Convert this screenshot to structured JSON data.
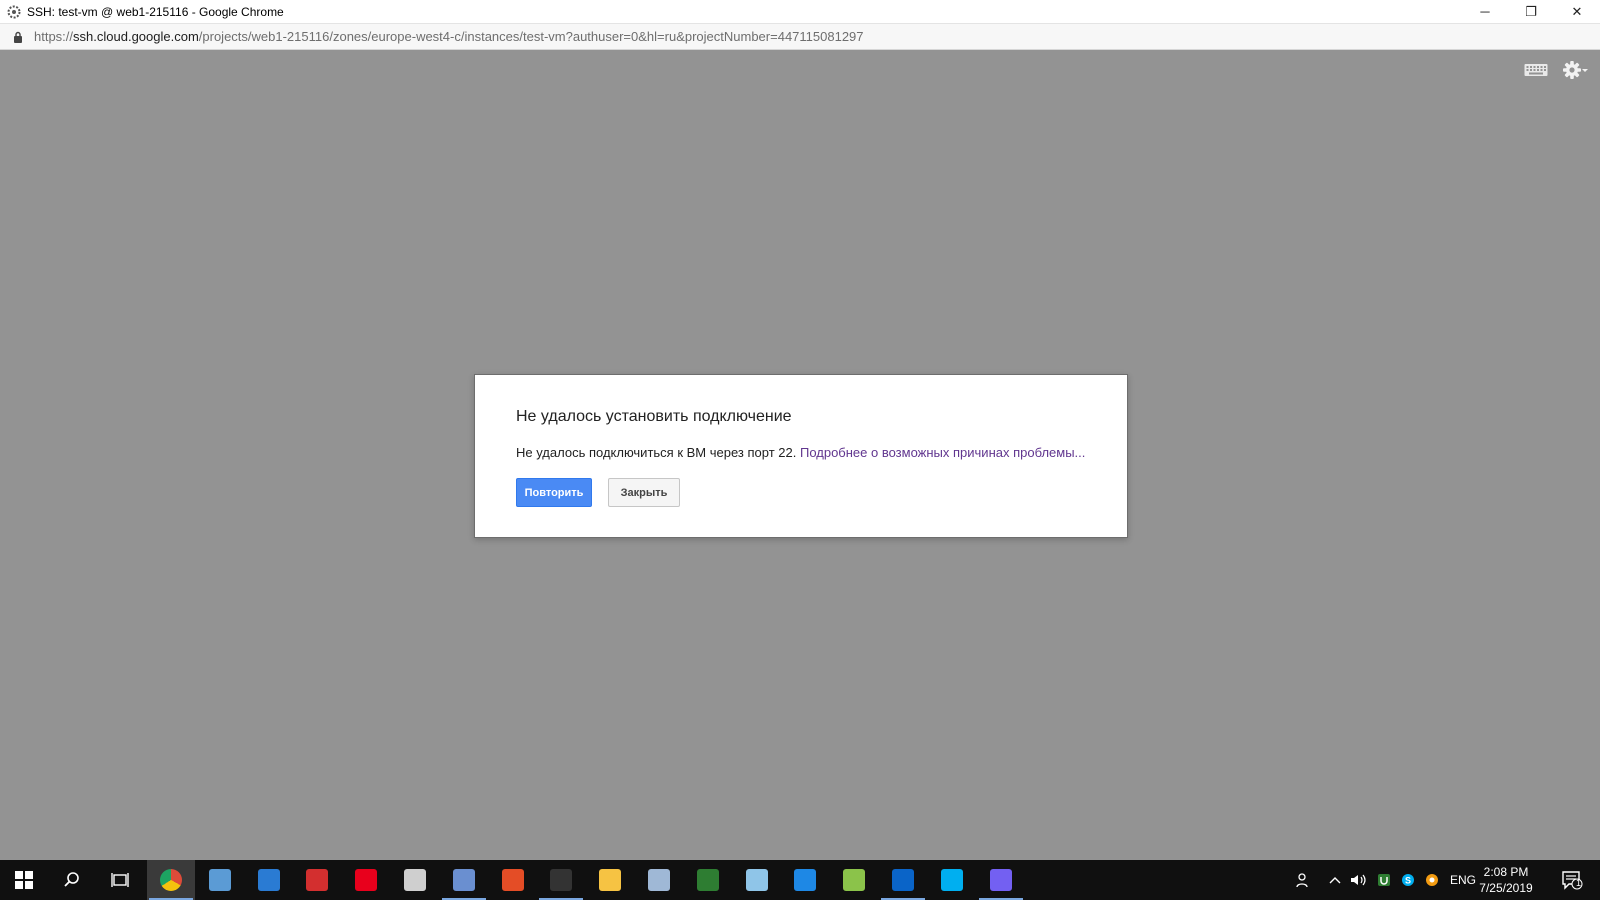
{
  "window": {
    "title": "SSH: test-vm @ web1-215116 - Google Chrome",
    "minimize": "─",
    "restore": "❐",
    "close": "✕"
  },
  "address": {
    "scheme": "https://",
    "host": "ssh.cloud.google.com",
    "path": "/projects/web1-215116/zones/europe-west4-c/instances/test-vm?authuser=0&hl=ru&projectNumber=447115081297"
  },
  "dialog": {
    "title": "Не удалось установить подключение",
    "message": "Не удалось подключиться к ВМ через порт 22.",
    "link": "Подробнее о возможных причинах проблемы...",
    "retry_label": "Повторить",
    "close_label": "Закрыть"
  },
  "taskbar": {
    "apps": [
      {
        "name": "chrome",
        "color": "#dd4b39"
      },
      {
        "name": "network-tool",
        "color": "#5b9bd5"
      },
      {
        "name": "vscode",
        "color": "#2a7bd3"
      },
      {
        "name": "red-app",
        "color": "#d32f2f"
      },
      {
        "name": "opera",
        "color": "#e8001c"
      },
      {
        "name": "calculator",
        "color": "#cfcfcf"
      },
      {
        "name": "remote-desktop",
        "color": "#6a8fd0"
      },
      {
        "name": "red-swirl",
        "color": "#e44d26"
      },
      {
        "name": "terminal",
        "color": "#333333"
      },
      {
        "name": "file-explorer",
        "color": "#f6c343"
      },
      {
        "name": "paint",
        "color": "#9fb8d6"
      },
      {
        "name": "green-u-app",
        "color": "#2e7d32"
      },
      {
        "name": "notes-app",
        "color": "#8fc5e8"
      },
      {
        "name": "blue-circle-app",
        "color": "#1e88e5"
      },
      {
        "name": "notepad-plus",
        "color": "#8bc34a"
      },
      {
        "name": "outlook",
        "color": "#0a64c8"
      },
      {
        "name": "skype",
        "color": "#00aff0"
      },
      {
        "name": "viber",
        "color": "#7360f2"
      }
    ],
    "lang": "ENG",
    "time": "2:08 PM",
    "date": "7/25/2019",
    "notification_count": "1"
  },
  "colors": {
    "content_bg": "#939393",
    "primary_button": "#4a8af4",
    "link": "#61368f"
  }
}
